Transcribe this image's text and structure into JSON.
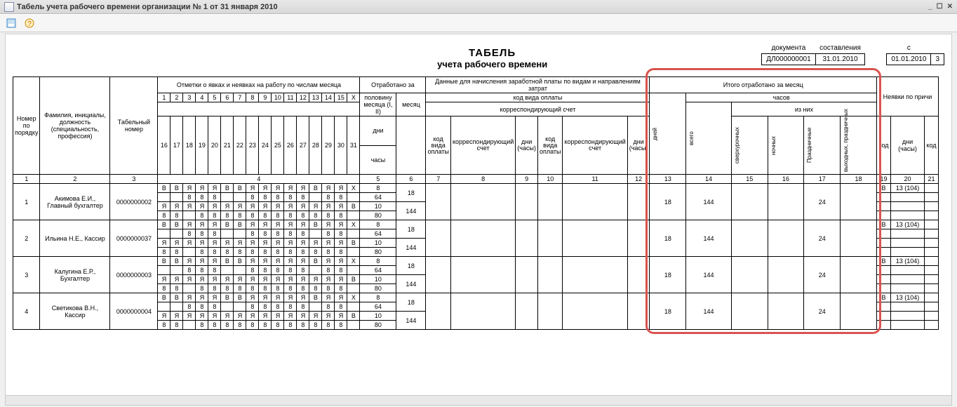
{
  "window": {
    "title": "Табель учета рабочего времени организации № 1 от 31 января 2010"
  },
  "doc_header": {
    "title1": "ТАБЕЛЬ",
    "title2": "учета  рабочего времени",
    "lbl_document": "документа",
    "lbl_sostav": "составления",
    "doc_num": "ДЛ000000001",
    "doc_date": "31.01.2010",
    "lbl_s": "с",
    "period_start": "01.01.2010",
    "period_end_part": "3"
  },
  "columns": {
    "c1": "Номер по порядку",
    "c2": "Фамилия, инициалы, должность (специальность, профессия)",
    "c3": "Табельный номер",
    "c4_group": "Отметки о явках и неявках на работу по числам месяца",
    "days_top": [
      "1",
      "2",
      "3",
      "4",
      "5",
      "6",
      "7",
      "8",
      "9",
      "10",
      "11",
      "12",
      "13",
      "14",
      "15",
      "X"
    ],
    "days_bot": [
      "16",
      "17",
      "18",
      "19",
      "20",
      "21",
      "22",
      "23",
      "24",
      "25",
      "26",
      "27",
      "28",
      "29",
      "30",
      "31"
    ],
    "c5_group": "Отработано за",
    "c5a": "половину месяца (I, II)",
    "c5b": "месяц",
    "c5a_sub1": "дни",
    "c5a_sub2": "часы",
    "c6_group": "Данные для начисления заработной платы по видам и направлениям затрат",
    "c6_sub1": "код вида оплаты",
    "c6_sub2": "корреспондирующий счет",
    "c6_a": "код вида оплаты",
    "c6_b": "корреспондирующий счет",
    "c6_c": "дни (часы)",
    "c13_group": "Итого отработано за месяц",
    "c13": "дней",
    "c14_group": "часов",
    "c14_sub": "из них",
    "c14": "всего",
    "c15": "сверхурочных",
    "c16": "ночных",
    "c17": "Праздничные",
    "c18": "выходных, праздничных",
    "c20_group": "Неявки по причи",
    "c19": "код",
    "c20": "дни (часы)",
    "c21": "код",
    "colnums": [
      "1",
      "2",
      "3",
      "4",
      "5",
      "6",
      "7",
      "8",
      "9",
      "10",
      "11",
      "12",
      "13",
      "14",
      "15",
      "16",
      "17",
      "18",
      "19",
      "20",
      "21"
    ]
  },
  "rows": [
    {
      "n": "1",
      "name": "Акимова Е.И., Главный бухгалтер",
      "tabnum": "0000000002",
      "marks1": [
        "В",
        "В",
        "Я",
        "Я",
        "Я",
        "В",
        "В",
        "Я",
        "Я",
        "Я",
        "Я",
        "Я",
        "В",
        "Я",
        "Я",
        "X"
      ],
      "hrs1": [
        "",
        "",
        "8",
        "8",
        "8",
        "",
        "",
        "8",
        "8",
        "8",
        "8",
        "8",
        "",
        "8",
        "8",
        ""
      ],
      "marks2": [
        "Я",
        "Я",
        "Я",
        "Я",
        "Я",
        "Я",
        "Я",
        "Я",
        "Я",
        "Я",
        "Я",
        "Я",
        "Я",
        "Я",
        "Я",
        "В"
      ],
      "hrs2": [
        "8",
        "8",
        "",
        "8",
        "8",
        "8",
        "8",
        "8",
        "8",
        "8",
        "8",
        "8",
        "8",
        "8",
        "8",
        ""
      ],
      "half_days": [
        "8",
        "10"
      ],
      "half_hours": [
        "64",
        "80"
      ],
      "month_days": "18",
      "month_hours": "144",
      "tot_days": "18",
      "tot_hours": "144",
      "holiday": "24",
      "abs_code": "В",
      "abs_val": "13 (104)"
    },
    {
      "n": "2",
      "name": "Ильина Н.Е., Кассир",
      "tabnum": "0000000037",
      "marks1": [
        "В",
        "В",
        "Я",
        "Я",
        "Я",
        "В",
        "В",
        "Я",
        "Я",
        "Я",
        "Я",
        "Я",
        "В",
        "Я",
        "Я",
        "X"
      ],
      "hrs1": [
        "",
        "",
        "8",
        "8",
        "8",
        "",
        "",
        "8",
        "8",
        "8",
        "8",
        "8",
        "",
        "8",
        "8",
        ""
      ],
      "marks2": [
        "Я",
        "Я",
        "Я",
        "Я",
        "Я",
        "Я",
        "Я",
        "Я",
        "Я",
        "Я",
        "Я",
        "Я",
        "Я",
        "Я",
        "Я",
        "В"
      ],
      "hrs2": [
        "8",
        "8",
        "",
        "8",
        "8",
        "8",
        "8",
        "8",
        "8",
        "8",
        "8",
        "8",
        "8",
        "8",
        "8",
        ""
      ],
      "half_days": [
        "8",
        "10"
      ],
      "half_hours": [
        "64",
        "80"
      ],
      "month_days": "18",
      "month_hours": "144",
      "tot_days": "18",
      "tot_hours": "144",
      "holiday": "24",
      "abs_code": "В",
      "abs_val": "13 (104)"
    },
    {
      "n": "3",
      "name": "Калугина Е.Р., Бухгалтер",
      "tabnum": "0000000003",
      "marks1": [
        "В",
        "В",
        "Я",
        "Я",
        "Я",
        "В",
        "В",
        "Я",
        "Я",
        "Я",
        "Я",
        "Я",
        "В",
        "Я",
        "Я",
        "X"
      ],
      "hrs1": [
        "",
        "",
        "8",
        "8",
        "8",
        "",
        "",
        "8",
        "8",
        "8",
        "8",
        "8",
        "",
        "8",
        "8",
        ""
      ],
      "marks2": [
        "Я",
        "Я",
        "Я",
        "Я",
        "Я",
        "Я",
        "Я",
        "Я",
        "Я",
        "Я",
        "Я",
        "Я",
        "Я",
        "Я",
        "Я",
        "В"
      ],
      "hrs2": [
        "8",
        "8",
        "",
        "8",
        "8",
        "8",
        "8",
        "8",
        "8",
        "8",
        "8",
        "8",
        "8",
        "8",
        "8",
        ""
      ],
      "half_days": [
        "8",
        "10"
      ],
      "half_hours": [
        "64",
        "80"
      ],
      "month_days": "18",
      "month_hours": "144",
      "tot_days": "18",
      "tot_hours": "144",
      "holiday": "24",
      "abs_code": "В",
      "abs_val": "13 (104)"
    },
    {
      "n": "4",
      "name": "Светикова В.Н., Кассир",
      "tabnum": "0000000004",
      "marks1": [
        "В",
        "В",
        "Я",
        "Я",
        "Я",
        "В",
        "В",
        "Я",
        "Я",
        "Я",
        "Я",
        "Я",
        "В",
        "Я",
        "Я",
        "X"
      ],
      "hrs1": [
        "",
        "",
        "8",
        "8",
        "8",
        "",
        "",
        "8",
        "8",
        "8",
        "8",
        "8",
        "",
        "8",
        "8",
        ""
      ],
      "marks2": [
        "Я",
        "Я",
        "Я",
        "Я",
        "Я",
        "Я",
        "Я",
        "Я",
        "Я",
        "Я",
        "Я",
        "Я",
        "Я",
        "Я",
        "Я",
        "В"
      ],
      "hrs2": [
        "8",
        "8",
        "",
        "8",
        "8",
        "8",
        "8",
        "8",
        "8",
        "8",
        "8",
        "8",
        "8",
        "8",
        "8",
        ""
      ],
      "half_days": [
        "8",
        "10"
      ],
      "half_hours": [
        "64",
        "80"
      ],
      "month_days": "18",
      "month_hours": "144",
      "tot_days": "18",
      "tot_hours": "144",
      "holiday": "24",
      "abs_code": "В",
      "abs_val": "13 (104)"
    }
  ]
}
